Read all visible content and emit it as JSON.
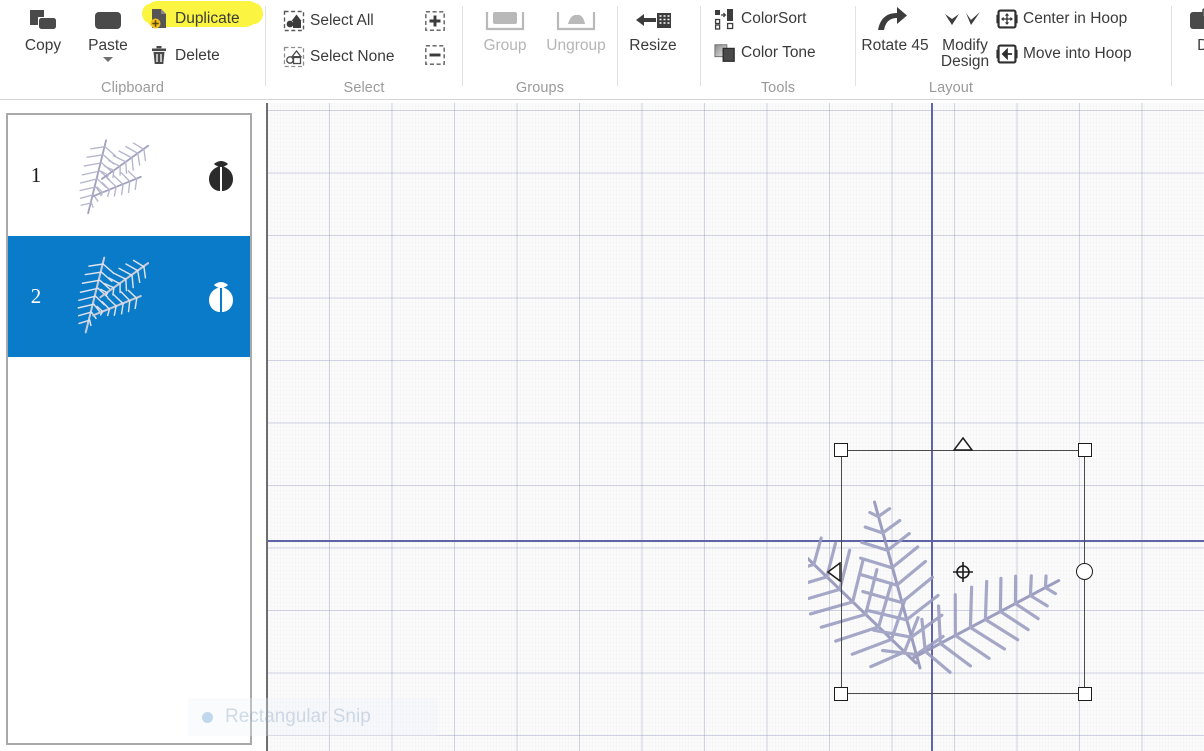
{
  "ribbon": {
    "groups": [
      {
        "name": "Clipboard",
        "label": "Clipboard",
        "big_buttons": [
          {
            "label": "Copy",
            "icon": "copy-icon",
            "enabled": true
          },
          {
            "label": "Paste",
            "icon": "paste-icon",
            "enabled": true,
            "has_dropdown": true
          }
        ],
        "small_buttons": [
          {
            "label": "Duplicate",
            "icon": "duplicate-icon",
            "enabled": true,
            "highlighted": true
          },
          {
            "label": "Delete",
            "icon": "trash-icon",
            "enabled": true
          }
        ]
      },
      {
        "name": "Select",
        "label": "Select",
        "small_buttons": [
          {
            "label": "Select All",
            "icon": "select-all-icon",
            "enabled": true
          },
          {
            "label": "Select None",
            "icon": "select-none-icon",
            "enabled": true
          },
          {
            "label": "",
            "icon": "add-to-selection-icon",
            "enabled": true
          },
          {
            "label": "",
            "icon": "remove-from-selection-icon",
            "enabled": true
          }
        ]
      },
      {
        "name": "Groups",
        "label": "Groups",
        "big_buttons": [
          {
            "label": "Group",
            "icon": "group-icon",
            "enabled": false
          },
          {
            "label": "Ungroup",
            "icon": "ungroup-icon",
            "enabled": false
          }
        ]
      },
      {
        "name": "Resize",
        "label": "",
        "big_buttons": [
          {
            "label": "Resize",
            "icon": "resize-icon",
            "enabled": true
          }
        ]
      },
      {
        "name": "Tools",
        "label": "Tools",
        "small_buttons": [
          {
            "label": "ColorSort",
            "icon": "colorsort-icon",
            "enabled": true
          },
          {
            "label": "Color Tone",
            "icon": "colortone-icon",
            "enabled": true
          }
        ]
      },
      {
        "name": "Layout",
        "label": "Layout",
        "big_buttons": [
          {
            "label": "Rotate 45",
            "icon": "rotate-45-icon",
            "enabled": true
          },
          {
            "label": "Modify Design",
            "icon": "modify-design-icon",
            "enabled": true
          }
        ],
        "small_buttons": [
          {
            "label": "Center in Hoop",
            "icon": "center-in-hoop-icon",
            "enabled": true
          },
          {
            "label": "Move into Hoop",
            "icon": "move-into-hoop-icon",
            "enabled": true
          }
        ]
      },
      {
        "name": "Design",
        "label": "",
        "big_buttons": [
          {
            "label": "De",
            "icon": "export-design-icon",
            "enabled": true
          }
        ]
      }
    ]
  },
  "design_list": {
    "items": [
      {
        "number": "1",
        "selected": false,
        "flag_icon": "tulip-icon",
        "thumbnail": "fern-leaves-embroidery"
      },
      {
        "number": "2",
        "selected": true,
        "flag_icon": "tulip-icon",
        "thumbnail": "fern-leaves-embroidery"
      }
    ]
  },
  "canvas": {
    "selection": {
      "handles": [
        "top-left-resize-handle",
        "top-right-resize-handle",
        "bottom-left-resize-handle",
        "bottom-right-resize-handle",
        "top-center-flip-vertical-handle",
        "left-center-flip-horizontal-handle",
        "right-center-rotate-handle",
        "center-move-handle"
      ]
    },
    "design_name": "fern-leaves-embroidery"
  },
  "snip_toast": {
    "label": "Rectangular Snip"
  },
  "colors": {
    "selection_blue": "#0a7bc8",
    "highlight_yellow": "#fbf431",
    "stitch_lavender": "#9a9cc0",
    "grid_line": "#9698be",
    "axis_line": "#5f63a8",
    "ribbon_text": "#3b3b3b",
    "ribbon_group_label": "#9a9a9a",
    "disabled_text": "#b5b5b5"
  }
}
